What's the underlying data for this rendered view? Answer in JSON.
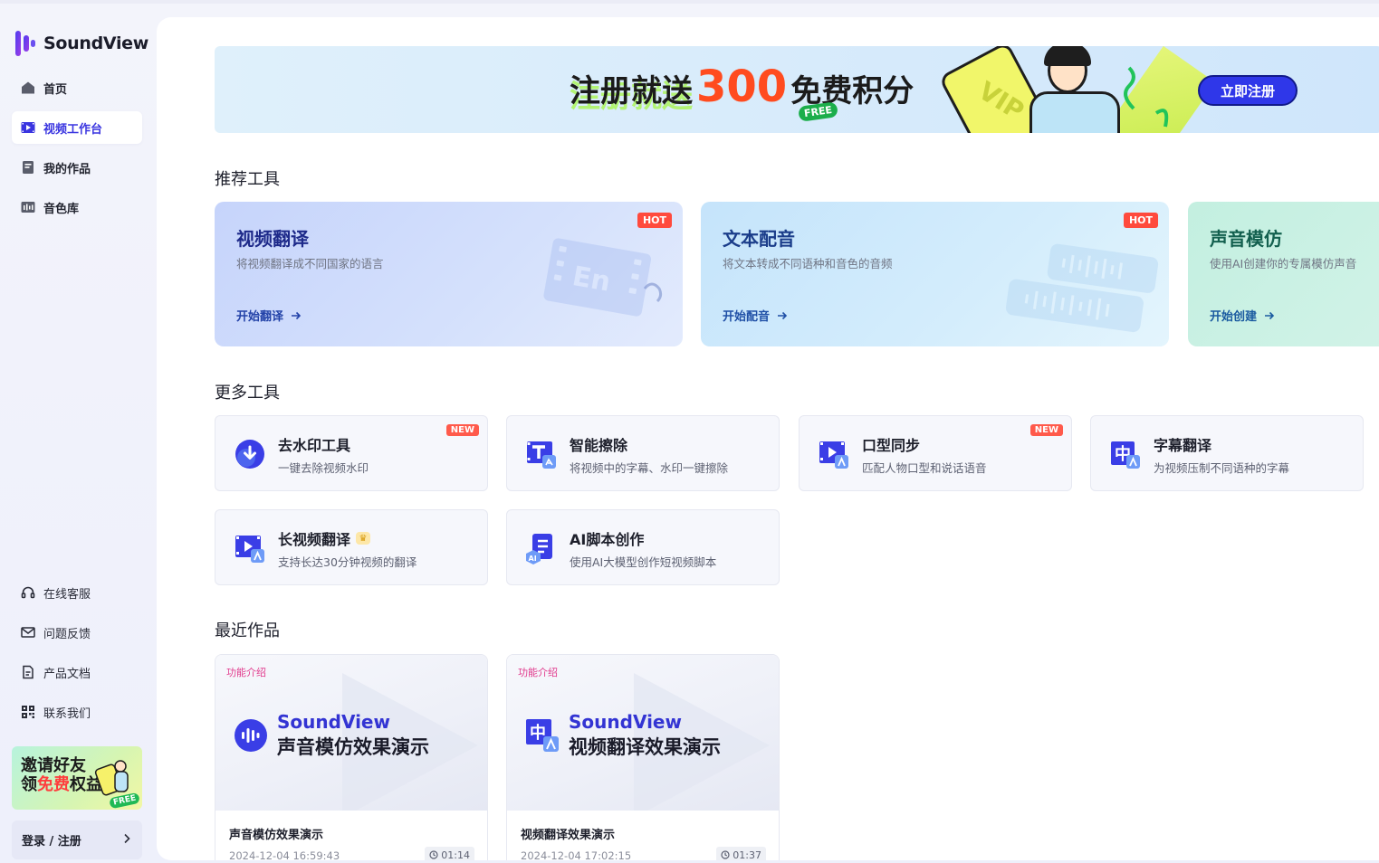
{
  "brand": {
    "name": "SoundView"
  },
  "nav": [
    {
      "label": "首页",
      "icon": "home-icon",
      "active": false
    },
    {
      "label": "视频工作台",
      "icon": "video-workbench-icon",
      "active": true
    },
    {
      "label": "我的作品",
      "icon": "my-works-icon",
      "active": false
    },
    {
      "label": "音色库",
      "icon": "voice-library-icon",
      "active": false
    }
  ],
  "bottom_links": [
    {
      "label": "在线客服",
      "icon": "headset-icon"
    },
    {
      "label": "问题反馈",
      "icon": "mail-icon"
    },
    {
      "label": "产品文档",
      "icon": "document-icon"
    },
    {
      "label": "联系我们",
      "icon": "qrcode-icon"
    }
  ],
  "invite": {
    "line1": "邀请好友",
    "line2_a": "领",
    "line2_hl": "免费",
    "line2_b": "权益",
    "badge": "FREE"
  },
  "login": {
    "label": "登录 / 注册"
  },
  "banner": {
    "text1": "注册就送",
    "number": "300",
    "text2": "免费积分",
    "free_badge": "FREE",
    "vip": "VIP",
    "button": "立即注册"
  },
  "sections": {
    "recommended": "推荐工具",
    "more": "更多工具",
    "recent": "最近作品"
  },
  "recommended_tools": [
    {
      "title": "视频翻译",
      "desc": "将视频翻译成不同国家的语言",
      "cta": "开始翻译",
      "badge": "HOT",
      "deco_text": "En"
    },
    {
      "title": "文本配音",
      "desc": "将文本转成不同语种和音色的音频",
      "cta": "开始配音",
      "badge": "HOT"
    },
    {
      "title": "声音模仿",
      "desc": "使用AI创建你的专属模仿声音",
      "cta": "开始创建",
      "badge": ""
    }
  ],
  "more_tools": [
    {
      "name": "去水印工具",
      "desc": "一键去除视频水印",
      "badge": "NEW",
      "icon": "download-icon"
    },
    {
      "name": "智能擦除",
      "desc": "将视频中的字幕、水印一键擦除",
      "badge": "",
      "icon": "text-erase-icon"
    },
    {
      "name": "口型同步",
      "desc": "匹配人物口型和说话语音",
      "badge": "NEW",
      "icon": "lip-sync-icon"
    },
    {
      "name": "字幕翻译",
      "desc": "为视频压制不同语种的字幕",
      "badge": "",
      "icon": "subtitle-translate-icon"
    },
    {
      "name": "长视频翻译",
      "desc": "支持长达30分钟视频的翻译",
      "badge": "",
      "icon": "long-video-icon",
      "crown": true
    },
    {
      "name": "AI脚本创作",
      "desc": "使用AI大模型创作短视频脚本",
      "badge": "",
      "icon": "ai-script-icon"
    }
  ],
  "recent_works": [
    {
      "tag": "功能介绍",
      "logo": "SoundView",
      "subtitle": "声音模仿效果演示",
      "name": "声音模仿效果演示",
      "date": "2024-12-04 16:59:43",
      "duration": "01:14"
    },
    {
      "tag": "功能介绍",
      "logo": "SoundView",
      "subtitle": "视频翻译效果演示",
      "name": "视频翻译效果演示",
      "date": "2024-12-04 17:02:15",
      "duration": "01:37"
    }
  ],
  "colors": {
    "accent": "#3a35e0",
    "hot": "#ff4a3d",
    "tag": "#e1388c"
  }
}
